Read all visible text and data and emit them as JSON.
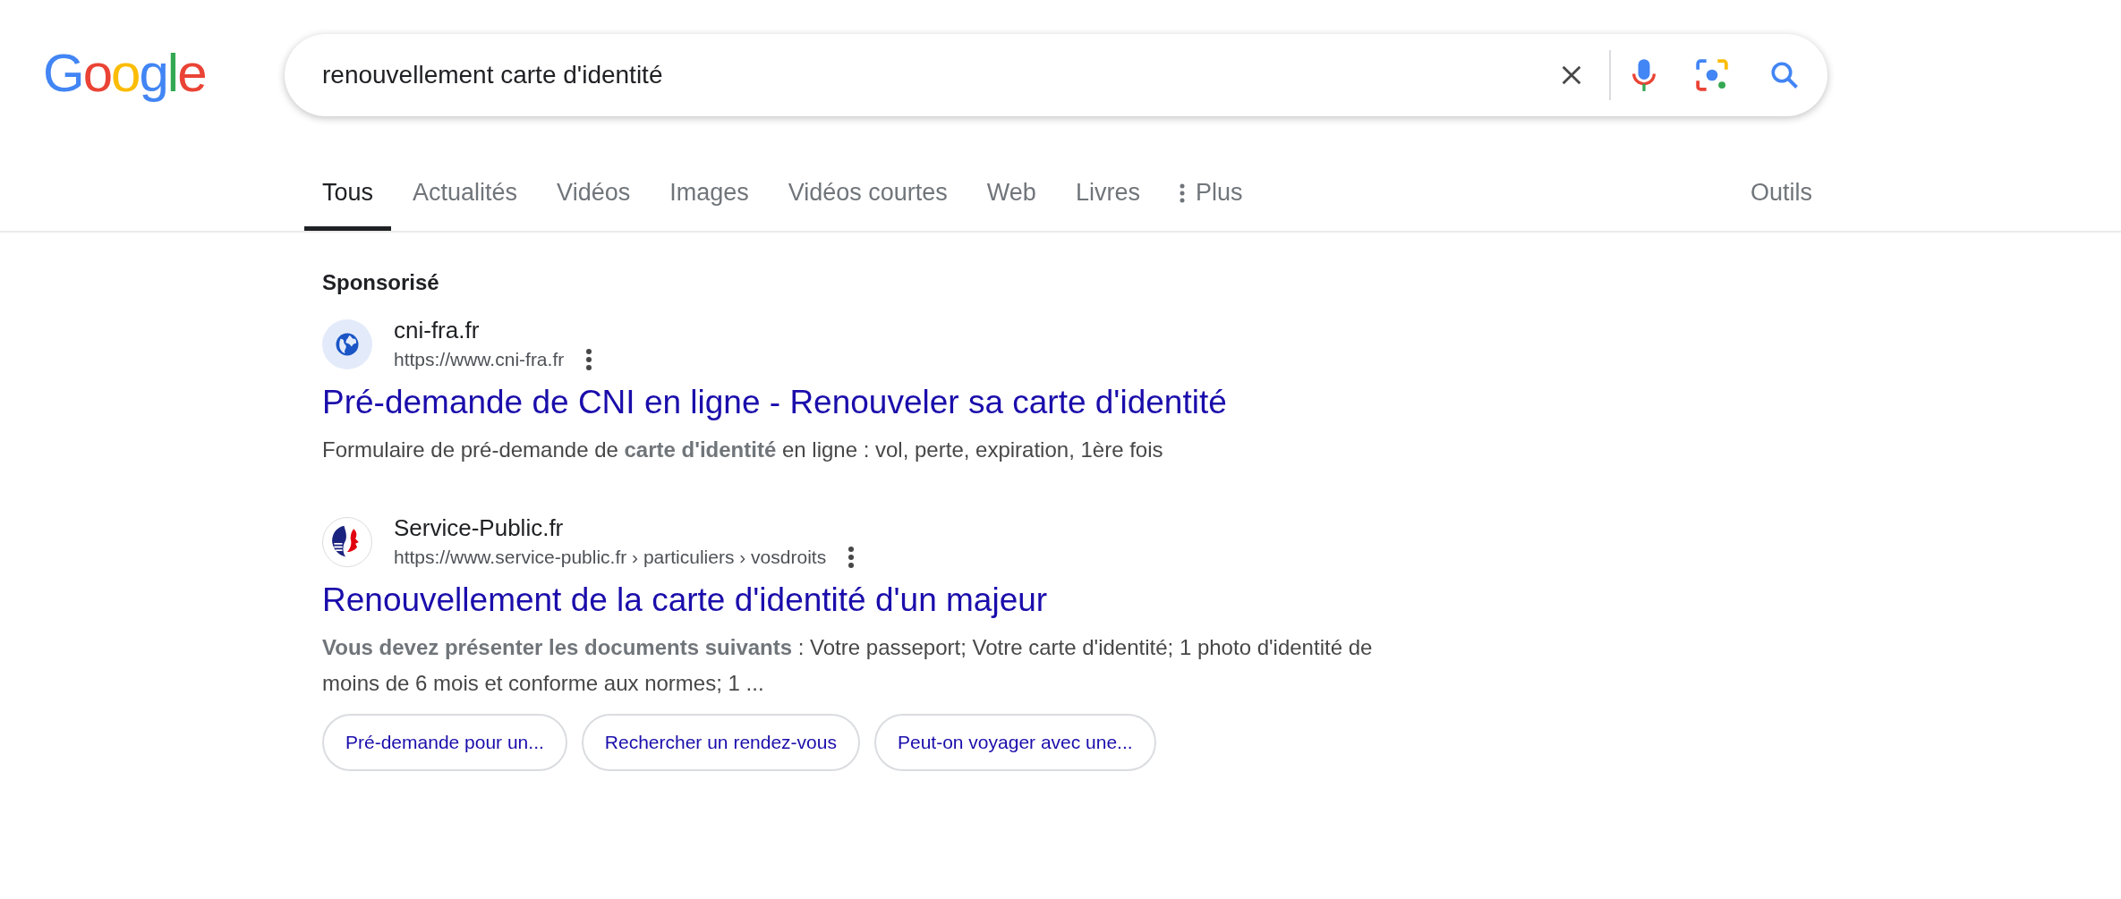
{
  "logo": "Google",
  "search": {
    "value": "renouvellement carte d'identité"
  },
  "tabs": [
    {
      "label": "Tous",
      "selected": true
    },
    {
      "label": "Actualités",
      "selected": false
    },
    {
      "label": "Vidéos",
      "selected": false
    },
    {
      "label": "Images",
      "selected": false
    },
    {
      "label": "Vidéos courtes",
      "selected": false
    },
    {
      "label": "Web",
      "selected": false
    },
    {
      "label": "Livres",
      "selected": false
    },
    {
      "label": "Plus",
      "selected": false,
      "kind": "more"
    }
  ],
  "tools": "Outils",
  "sponsored_label": "Sponsorisé",
  "results": [
    {
      "kind": "globe",
      "site": "cni-fra.fr",
      "url": "https://www.cni-fra.fr",
      "title": "Pré-demande de CNI en ligne - Renouveler sa carte d'identité",
      "snippet": "Formulaire de pré-demande de **carte d'identité** en ligne : vol, perte, expiration, 1ère fois"
    },
    {
      "kind": "marianne",
      "site": "Service-Public.fr",
      "url": "https://www.service-public.fr › particuliers › vosdroits",
      "title": "Renouvellement de la carte d'identité d'un majeur",
      "snippet": "**Vous devez présenter les documents suivants** : Votre passeport; Votre carte d'identité; 1 photo d'identité de moins de 6 mois et conforme aux normes; 1 ...",
      "chips": [
        "Pré-demande pour un...",
        "Rechercher un rendez-vous",
        "Peut-on voyager avec une..."
      ]
    }
  ]
}
